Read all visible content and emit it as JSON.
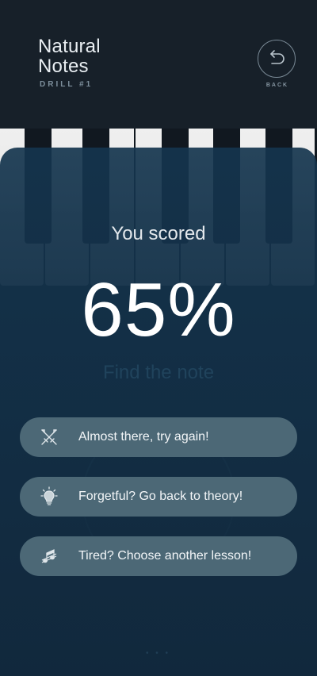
{
  "header": {
    "title_line1": "Natural",
    "title_line2": "Notes",
    "subtitle": "DRILL #1",
    "back_label": "BACK"
  },
  "result": {
    "scored_label": "You scored",
    "score": "65%",
    "background_prompt": "Find the note"
  },
  "options": [
    {
      "label": "Almost there, try again!",
      "icon": "crossed-swords-icon"
    },
    {
      "label": "Forgetful? Go back to theory!",
      "icon": "lightbulb-icon"
    },
    {
      "label": "Tired? Choose another lesson!",
      "icon": "music-notes-icon"
    }
  ],
  "colors": {
    "header_bg": "#172029",
    "overlay_bg": "#15354e",
    "option_bg": "#4c6876",
    "text": "#ffffff"
  }
}
